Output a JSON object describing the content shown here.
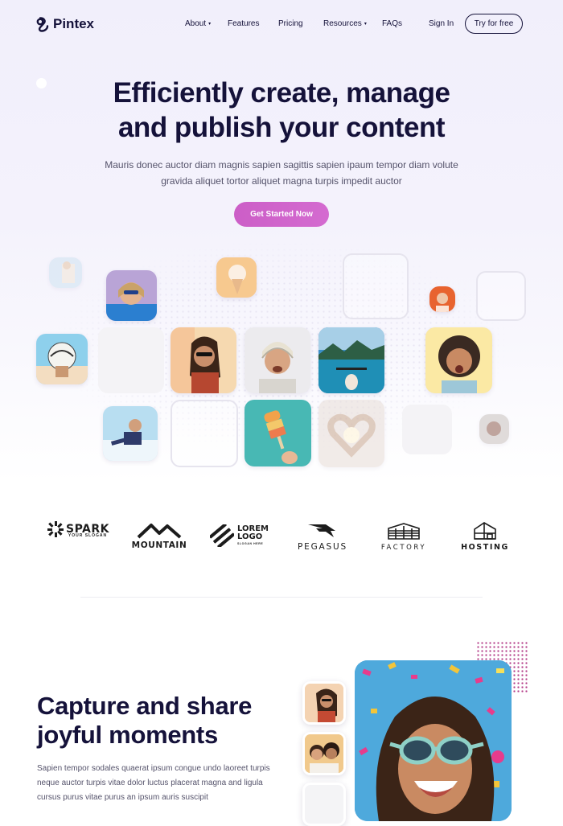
{
  "brand": {
    "name": "Pintex"
  },
  "nav": {
    "about": "About",
    "features": "Features",
    "pricing": "Pricing",
    "resources": "Resources",
    "faqs": "FAQs",
    "sign_in": "Sign In",
    "try_free": "Try for free"
  },
  "hero": {
    "title_line1": "Efficiently create, manage",
    "title_line2": "and publish your content",
    "subtitle": "Mauris donec auctor diam magnis sapien sagittis sapien ipaum tempor diam volute gravida aliquet tortor aliquet magna turpis impedit auctor",
    "cta": "Get Started Now"
  },
  "logos": [
    {
      "name": "SPARK",
      "tagline": "YOUR SLOGAN",
      "icon": "spark-logo-icon"
    },
    {
      "name": "MOUNTAIN",
      "icon": "mountain-logo-icon"
    },
    {
      "name": "LOREM LOGO",
      "line1": "LOREM",
      "line2": "LOGO",
      "tagline": "SLOGAN HERE",
      "icon": "lorem-logo-icon"
    },
    {
      "name": "PEGASUS",
      "icon": "pegasus-logo-icon"
    },
    {
      "name": "FACTORY",
      "icon": "factory-logo-icon"
    },
    {
      "name": "HOSTING",
      "icon": "hosting-logo-icon"
    }
  ],
  "section": {
    "title_line1": "Capture and share",
    "title_line2": "joyful moments",
    "body": "Sapien tempor sodales quaerat ipsum congue undo laoreet turpis neque auctor turpis vitae dolor luctus placerat magna and ligula cursus purus vitae purus an ipsum auris suscipit"
  },
  "colors": {
    "accent": "#cc5ec7",
    "text_dark": "#15123a",
    "text_muted": "#55536b",
    "pattern": "#b23a86"
  }
}
